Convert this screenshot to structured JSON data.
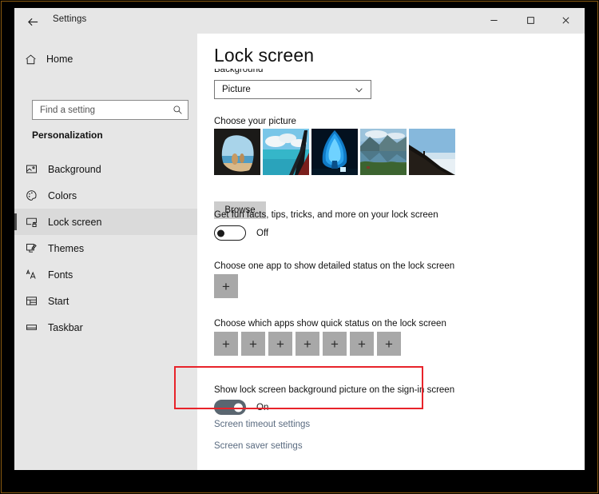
{
  "window": {
    "app_title": "Settings",
    "back_icon": "back-arrow-icon",
    "minimize_label": "–",
    "maximize_label": "□",
    "close_label": "✕"
  },
  "sidebar": {
    "home_label": "Home",
    "search": {
      "placeholder": "Find a setting",
      "value": "",
      "icon": "search-icon"
    },
    "section_title": "Personalization",
    "items": [
      {
        "label": "Background",
        "icon": "image-icon",
        "selected": false
      },
      {
        "label": "Colors",
        "icon": "palette-icon",
        "selected": false
      },
      {
        "label": "Lock screen",
        "icon": "lockscreen-icon",
        "selected": true
      },
      {
        "label": "Themes",
        "icon": "themes-icon",
        "selected": false
      },
      {
        "label": "Fonts",
        "icon": "fonts-icon",
        "selected": false
      },
      {
        "label": "Start",
        "icon": "start-icon",
        "selected": false
      },
      {
        "label": "Taskbar",
        "icon": "taskbar-icon",
        "selected": false
      }
    ]
  },
  "main": {
    "page_title": "Lock screen",
    "background_label": "Background",
    "background_select": {
      "value": "Picture",
      "chevron_icon": "chevron-down-icon"
    },
    "choose_picture_label": "Choose your picture",
    "thumbnails": [
      {
        "name": "cave-arch-beach"
      },
      {
        "name": "turquoise-sea-sailboat"
      },
      {
        "name": "blue-ice-cave"
      },
      {
        "name": "fjord-mirror-lake"
      },
      {
        "name": "dark-mountain-ridge"
      }
    ],
    "browse_label": "Browse",
    "fun_facts_label": "Get fun facts, tips, tricks, and more on your lock screen",
    "fun_facts_state": "Off",
    "detailed_status_label": "Choose one app to show detailed status on the lock screen",
    "detailed_status_add": "+",
    "quick_status_label": "Choose which apps show quick status on the lock screen",
    "quick_status_add": "+",
    "quick_status_count": 7,
    "signin_label": "Show lock screen background picture on the sign-in screen",
    "signin_state": "On",
    "links": [
      {
        "label": "Screen timeout settings"
      },
      {
        "label": "Screen saver settings"
      }
    ]
  },
  "annotation": {
    "highlight_color": "#e8232a"
  }
}
